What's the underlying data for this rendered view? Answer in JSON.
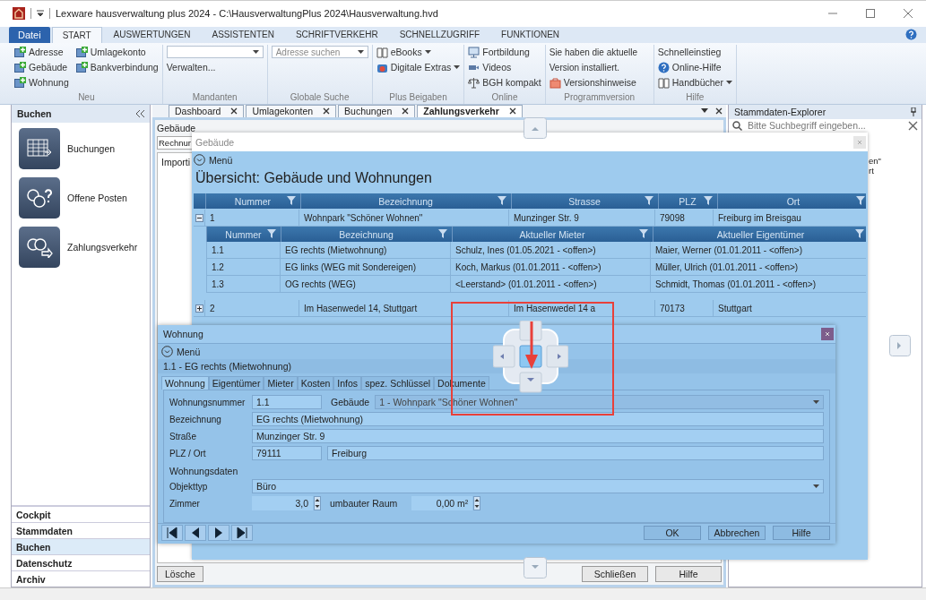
{
  "window": {
    "title": "Lexware hausverwaltung plus 2024 - C:\\HausverwaltungPlus 2024\\Hausverwaltung.hvd"
  },
  "ribbon": {
    "file_tab": "Datei",
    "tabs": [
      {
        "label": "START",
        "selected": true
      },
      {
        "label": "AUSWERTUNGEN",
        "selected": false
      },
      {
        "label": "ASSISTENTEN",
        "selected": false
      },
      {
        "label": "SCHRIFTVERKEHR",
        "selected": false
      },
      {
        "label": "SCHNELLZUGRIFF",
        "selected": false
      },
      {
        "label": "FUNKTIONEN",
        "selected": false
      }
    ],
    "groups": [
      {
        "label": "Neu",
        "items": [
          {
            "kind": "button",
            "label": "Adresse"
          },
          {
            "kind": "button",
            "label": "Gebäude"
          },
          {
            "kind": "button",
            "label": "Wohnung"
          },
          {
            "kind": "button",
            "label": "Umlagekonto"
          },
          {
            "kind": "button",
            "label": "Bankverbindung"
          }
        ]
      },
      {
        "label": "Mandanten",
        "items": [
          {
            "kind": "combo"
          },
          {
            "kind": "link",
            "label": "Verwalten..."
          }
        ]
      },
      {
        "label": "Globale Suche",
        "items": [
          {
            "kind": "combo",
            "placeholder": "Adresse suchen"
          }
        ]
      },
      {
        "label": "Plus Beigaben",
        "items": [
          {
            "kind": "dropdown",
            "label": "eBooks"
          },
          {
            "kind": "dropdown",
            "label": "Digitale Extras"
          }
        ]
      },
      {
        "label": "Online",
        "items": [
          {
            "kind": "button",
            "label": "Fortbildung"
          },
          {
            "kind": "button",
            "label": "Videos"
          },
          {
            "kind": "button",
            "label": "BGH kompakt"
          }
        ]
      },
      {
        "label": "Programmversion",
        "items": [
          {
            "kind": "note",
            "label": "Sie haben die aktuelle Version installiert."
          },
          {
            "kind": "button",
            "label": "Versionshinweise"
          }
        ]
      },
      {
        "label": "Hilfe",
        "items": [
          {
            "kind": "link",
            "label": "Schnelleinstieg"
          },
          {
            "kind": "button",
            "label": "Online-Hilfe"
          },
          {
            "kind": "dropdown",
            "label": "Handbücher"
          }
        ]
      }
    ]
  },
  "left_pane": {
    "title": "Buchen",
    "tiles": [
      {
        "label": "Buchungen"
      },
      {
        "label": "Offene Posten"
      },
      {
        "label": "Zahlungsverkehr"
      }
    ],
    "nav": [
      {
        "label": "Cockpit",
        "selected": false
      },
      {
        "label": "Stammdaten",
        "selected": false
      },
      {
        "label": "Buchen",
        "selected": true
      },
      {
        "label": "Datenschutz",
        "selected": false
      },
      {
        "label": "Archiv",
        "selected": false
      }
    ]
  },
  "documents": {
    "tabs": [
      {
        "label": "Dashboard",
        "selected": false
      },
      {
        "label": "Umlagekonten",
        "selected": false
      },
      {
        "label": "Buchungen",
        "selected": false
      },
      {
        "label": "Zahlungsverkehr",
        "selected": true
      }
    ],
    "field_label": "Gebäude",
    "inner_tab": "Rechnur",
    "column": "Importi",
    "delete_button": "Lösche",
    "buttons": [
      "Schließen",
      "Hilfe"
    ]
  },
  "explorer": {
    "title": "Stammdaten-Explorer",
    "search_placeholder": "Bitte Suchbegriff eingeben...",
    "items": [
      "en\"",
      "rt"
    ]
  },
  "building_window": {
    "title": "Gebäude",
    "menu": "Menü",
    "heading": "Übersicht: Gebäude und Wohnungen",
    "columns": [
      "Nummer",
      "Bezeichnung",
      "Strasse",
      "PLZ",
      "Ort"
    ],
    "rows": [
      {
        "cells": [
          "1",
          "Wohnpark \"Schöner Wohnen\"",
          "Munzinger Str. 9",
          "79098",
          "Freiburg im Breisgau"
        ],
        "expanded": true,
        "children": {
          "columns": [
            "Nummer",
            "Bezeichnung",
            "Aktueller Mieter",
            "Aktueller Eigentümer"
          ],
          "rows": [
            [
              "1.1",
              "EG rechts (Mietwohnung)",
              "Schulz, Ines (01.05.2021 - <offen>)",
              "Maier, Werner (01.01.2011 - <offen>)"
            ],
            [
              "1.2",
              "EG links (WEG mit Sondereigen)",
              "Koch, Markus (01.01.2011 - <offen>)",
              "Müller, Ulrich (01.01.2011 - <offen>)"
            ],
            [
              "1.3",
              "OG rechts (WEG)",
              "<Leerstand> (01.01.2011 - <offen>)",
              "Schmidt, Thomas (01.01.2011 - <offen>)"
            ]
          ]
        }
      },
      {
        "cells": [
          "2",
          "Im Hasenwedel 14, Stuttgart",
          "Im Hasenwedel 14 a",
          "70173",
          "Stuttgart"
        ],
        "expanded": false
      }
    ]
  },
  "apartment_dialog": {
    "title": "Wohnung",
    "menu": "Menü",
    "subtitle": "1.1 - EG rechts (Mietwohnung)",
    "tabs": [
      {
        "label": "Wohnung",
        "selected": true
      },
      {
        "label": "Eigentümer",
        "selected": false
      },
      {
        "label": "Mieter",
        "selected": false
      },
      {
        "label": "Kosten",
        "selected": false
      },
      {
        "label": "Infos",
        "selected": false
      },
      {
        "label": "spez. Schlüssel",
        "selected": false
      },
      {
        "label": "Dokumente",
        "selected": false
      }
    ],
    "number": {
      "label": "Wohnungsnummer",
      "value": "1.1"
    },
    "building": {
      "label": "Gebäude",
      "value": "1 - Wohnpark \"Schöner Wohnen\""
    },
    "name": {
      "label": "Bezeichnung",
      "value": "EG rechts (Mietwohnung)"
    },
    "street": {
      "label": "Straße",
      "value": "Munzinger Str. 9"
    },
    "city": {
      "label": "PLZ / Ort",
      "zip": "79111",
      "value": "Freiburg"
    },
    "section": "Wohnungsdaten",
    "type": {
      "label": "Objekttyp",
      "value": "Büro"
    },
    "rooms": {
      "label": "Zimmer",
      "value": "3,0"
    },
    "volume": {
      "label": "umbauter Raum",
      "value": "0,00 m²"
    },
    "buttons": [
      "OK",
      "Abbrechen",
      "Hilfe"
    ]
  }
}
